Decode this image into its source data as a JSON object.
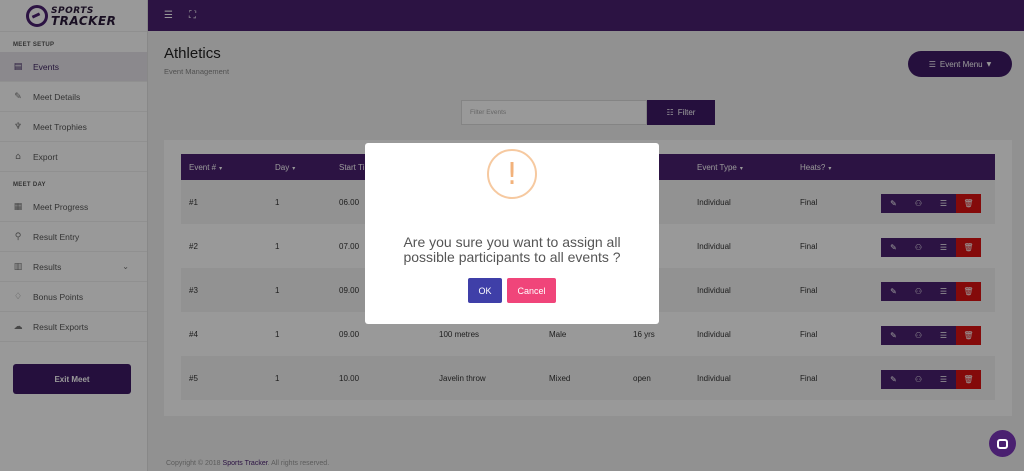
{
  "brand": {
    "line1": "SPORTS",
    "line2": "TRACKER"
  },
  "sidebar": {
    "meet_setup_title": "MEET SETUP",
    "setup_items": [
      {
        "label": "Events",
        "icon": "calendar-icon"
      },
      {
        "label": "Meet Details",
        "icon": "edit-icon"
      },
      {
        "label": "Meet Trophies",
        "icon": "trophy-icon"
      },
      {
        "label": "Export",
        "icon": "export-icon"
      }
    ],
    "meet_day_title": "MEET DAY",
    "day_items": [
      {
        "label": "Meet Progress",
        "icon": "grid-icon"
      },
      {
        "label": "Result Entry",
        "icon": "search-icon"
      },
      {
        "label": "Results",
        "icon": "bar-chart-icon"
      },
      {
        "label": "Bonus Points",
        "icon": "diamond-icon"
      },
      {
        "label": "Result Exports",
        "icon": "cloud-icon"
      }
    ],
    "exit_label": "Exit Meet"
  },
  "page": {
    "title": "Athletics",
    "subtitle": "Event Management"
  },
  "event_menu_label": "Event Menu",
  "filter": {
    "placeholder": "Filter Events",
    "button_label": "Filter"
  },
  "table": {
    "headers": [
      "Event #",
      "Day",
      "Start Ti",
      "Event Type",
      "Heats?"
    ],
    "rows": [
      {
        "event": "#1",
        "day": "1",
        "start": "06.00",
        "name": "",
        "gender": "",
        "age": "",
        "type": "Individual",
        "heats": "Final"
      },
      {
        "event": "#2",
        "day": "1",
        "start": "07.00",
        "name": "",
        "gender": "",
        "age": "",
        "type": "Individual",
        "heats": "Final"
      },
      {
        "event": "#3",
        "day": "1",
        "start": "09.00",
        "name": "",
        "gender": "",
        "age": "",
        "type": "Individual",
        "heats": "Final"
      },
      {
        "event": "#4",
        "day": "1",
        "start": "09.00",
        "name": "100 metres",
        "gender": "Male",
        "age": "16 yrs",
        "type": "Individual",
        "heats": "Final"
      },
      {
        "event": "#5",
        "day": "1",
        "start": "10.00",
        "name": "Javelin throw",
        "gender": "Mixed",
        "age": "open",
        "type": "Individual",
        "heats": "Final"
      }
    ]
  },
  "footer": {
    "prefix": "Copyright © 2018",
    "brand": "Sports Tracker",
    "suffix": ". All rights reserved."
  },
  "modal": {
    "icon": "!",
    "message": "Are you sure you want to assign all possible participants to all events ?",
    "ok_label": "OK",
    "cancel_label": "Cancel"
  },
  "colors": {
    "primary": "#4a2070",
    "danger": "#dd1111",
    "ok": "#3f3fa8",
    "cancel": "#f0457a",
    "warning": "#f2b27b"
  }
}
